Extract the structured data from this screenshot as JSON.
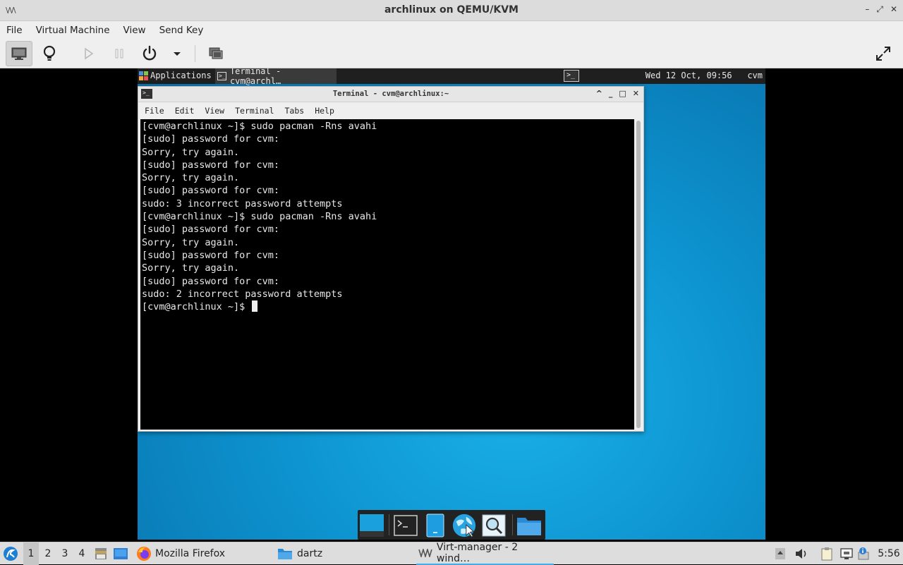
{
  "host": {
    "window_title": "archlinux on QEMU/KVM",
    "app_icon_text": "\\/\\/\\",
    "window_buttons": [
      "–",
      "⤢",
      "✕"
    ],
    "menu": [
      "File",
      "Virtual Machine",
      "View",
      "Send Key"
    ],
    "toolbar_icons": [
      "monitor-icon",
      "lightbulb-icon",
      "play-icon",
      "pause-icon",
      "power-icon",
      "dropdown-arrow-icon",
      "screens-icon",
      "fullscreen-icon"
    ]
  },
  "guest": {
    "panel": {
      "applications_label": "Applications",
      "task_label": "Terminal - cvm@archl…",
      "clock": "Wed 12 Oct, 09:56",
      "user": "cvm"
    },
    "terminal": {
      "title": "Terminal - cvm@archlinux:~",
      "icon_text": ">_",
      "menu": [
        "File",
        "Edit",
        "View",
        "Terminal",
        "Tabs",
        "Help"
      ],
      "lines": [
        "[cvm@archlinux ~]$ sudo pacman -Rns avahi",
        "[sudo] password for cvm:",
        "Sorry, try again.",
        "[sudo] password for cvm:",
        "Sorry, try again.",
        "[sudo] password for cvm:",
        "sudo: 3 incorrect password attempts",
        "[cvm@archlinux ~]$ sudo pacman -Rns avahi",
        "[sudo] password for cvm:",
        "Sorry, try again.",
        "[sudo] password for cvm:",
        "Sorry, try again.",
        "[sudo] password for cvm:",
        "sudo: 2 incorrect password attempts",
        "[cvm@archlinux ~]$ "
      ]
    },
    "dock_icons": [
      "desktop-icon",
      "terminal-icon",
      "file-manager-icon",
      "web-browser-icon",
      "search-icon",
      "folder-icon"
    ]
  },
  "taskbar": {
    "workspaces": [
      "1",
      "2",
      "3",
      "4"
    ],
    "active_workspace": "1",
    "tasks": [
      {
        "label": "Mozilla Firefox",
        "icon": "firefox-icon"
      },
      {
        "label": "dartz",
        "icon": "folder-icon"
      },
      {
        "label": "Virt-manager - 2 wind…",
        "icon": "virt-manager-icon",
        "active": true
      }
    ],
    "clock": "5:56"
  },
  "colors": {
    "guest_desktop": "#0d93cf",
    "accent": "#3daee9"
  }
}
